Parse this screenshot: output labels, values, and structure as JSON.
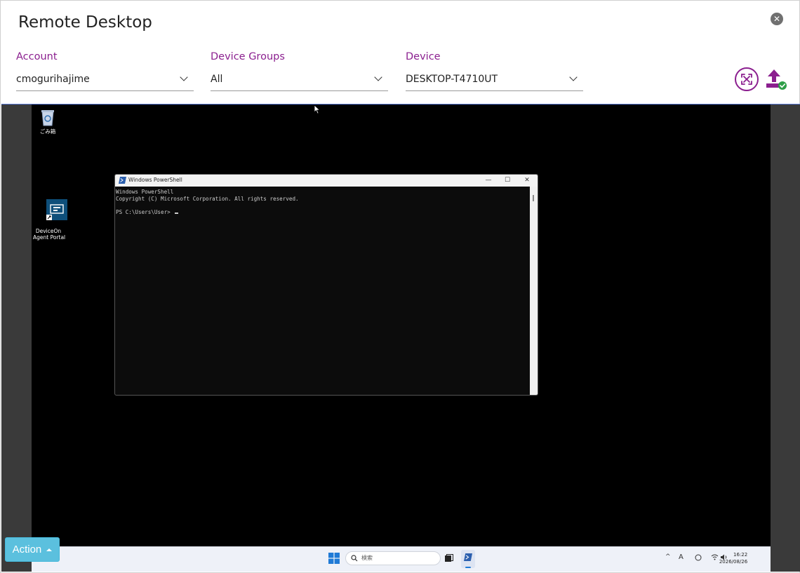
{
  "dialog": {
    "title": "Remote Desktop",
    "close_glyph": "✕"
  },
  "filters": {
    "account": {
      "label": "Account",
      "value": "cmogurihajime"
    },
    "device_groups": {
      "label": "Device Groups",
      "value": "All"
    },
    "device": {
      "label": "Device",
      "value": "DESKTOP-T4710UT"
    }
  },
  "toolbar": {
    "fullscreen_icon": "fullscreen-icon",
    "upload_icon": "upload-file-icon"
  },
  "remote": {
    "desktop_icons": [
      {
        "label": "ごみ箱",
        "icon": "recycle-bin-icon"
      },
      {
        "label": "DeviceOn\nAgent Portal",
        "icon": "deviceon-agent-icon"
      }
    ],
    "powershell": {
      "title": "Windows PowerShell",
      "lines": [
        "Windows PowerShell",
        "Copyright (C) Microsoft Corporation. All rights reserved.",
        "",
        "PS C:\\Users\\User> "
      ],
      "minimize": "—",
      "maximize": "☐",
      "close": "✕"
    },
    "taskbar": {
      "search_placeholder": "検索",
      "time": "16:22",
      "date": "2026/08/26",
      "ime": "A"
    }
  },
  "action_button": {
    "label": "Action"
  },
  "colors": {
    "accent": "#8b1f8f",
    "action": "#5bc0de",
    "success": "#2e9e47"
  }
}
